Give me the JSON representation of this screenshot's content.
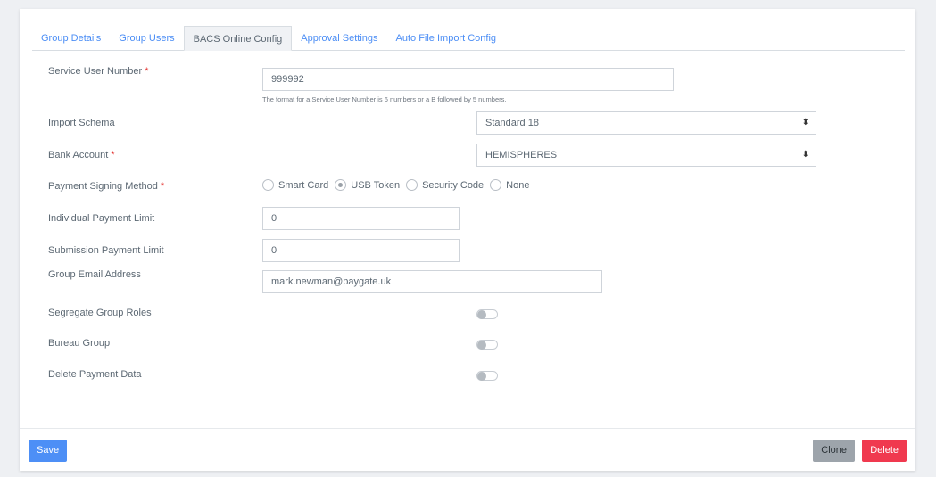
{
  "tabs": [
    {
      "label": "Group Details"
    },
    {
      "label": "Group Users"
    },
    {
      "label": "BACS Online Config"
    },
    {
      "label": "Approval Settings"
    },
    {
      "label": "Auto File Import Config"
    }
  ],
  "form": {
    "service_user_number": {
      "label": "Service User Number",
      "required": "*",
      "value": "999992",
      "help": "The format for a Service User Number is 6 numbers or a B followed by 5 numbers."
    },
    "import_schema": {
      "label": "Import Schema",
      "value": "Standard 18"
    },
    "bank_account": {
      "label": "Bank Account",
      "required": "*",
      "value": "HEMISPHERES"
    },
    "payment_signing_method": {
      "label": "Payment Signing Method",
      "required": "*",
      "options": [
        "Smart Card",
        "USB Token",
        "Security Code",
        "None"
      ],
      "selected": "USB Token"
    },
    "individual_payment_limit": {
      "label": "Individual Payment Limit",
      "value": "0"
    },
    "submission_payment_limit": {
      "label": "Submission Payment Limit",
      "value": "0"
    },
    "group_email_address": {
      "label": "Group Email Address",
      "value": "mark.newman@paygate.uk"
    },
    "segregate_group_roles": {
      "label": "Segregate Group Roles",
      "on": false
    },
    "bureau_group": {
      "label": "Bureau Group",
      "on": false
    },
    "delete_payment_data": {
      "label": "Delete Payment Data",
      "on": false
    }
  },
  "footer": {
    "save": "Save",
    "clone": "Clone",
    "delete": "Delete"
  },
  "colors": {
    "accent": "#4d8ff6",
    "danger": "#f0394f",
    "required": "#e4312e"
  }
}
